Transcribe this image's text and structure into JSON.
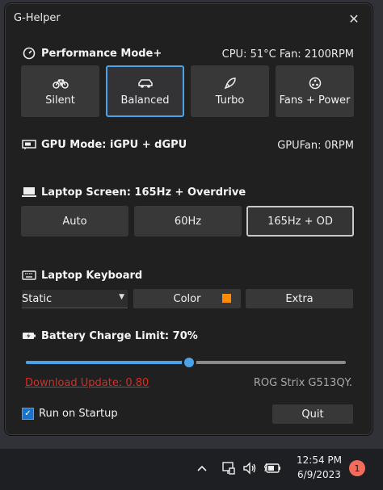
{
  "window": {
    "title": "G-Helper"
  },
  "performance": {
    "heading": "Performance Mode+",
    "status": "CPU: 51°C Fan: 2100RPM",
    "modes": [
      {
        "label": "Silent",
        "icon": "bicycle-icon",
        "selected": false
      },
      {
        "label": "Balanced",
        "icon": "car-icon",
        "selected": true
      },
      {
        "label": "Turbo",
        "icon": "rocket-icon",
        "selected": false
      },
      {
        "label": "Fans + Power",
        "icon": "fan-icon",
        "selected": false
      }
    ]
  },
  "gpu": {
    "heading": "GPU Mode: iGPU + dGPU",
    "status": "GPUFan: 0RPM"
  },
  "screen": {
    "heading": "Laptop Screen: 165Hz + Overdrive",
    "options": [
      {
        "label": "Auto",
        "selected": false
      },
      {
        "label": "60Hz",
        "selected": false
      },
      {
        "label": "165Hz + OD",
        "selected": true
      }
    ]
  },
  "keyboard": {
    "heading": "Laptop Keyboard",
    "mode_value": "Static",
    "color_label": "Color",
    "color_swatch": "#ff8c00",
    "extra_label": "Extra"
  },
  "battery": {
    "heading": "Battery Charge Limit: 70%",
    "limit_fraction": 0.51
  },
  "footer": {
    "update_link": "Download Update: 0.80",
    "model": "ROG Strix G513QY.",
    "startup_label": "Run on Startup",
    "startup_checked": true,
    "quit_label": "Quit"
  },
  "taskbar": {
    "time": "12:54 PM",
    "date": "6/9/2023",
    "notification_count": "1"
  },
  "colors": {
    "accent": "#4aa3e8",
    "link": "#e0291f"
  }
}
